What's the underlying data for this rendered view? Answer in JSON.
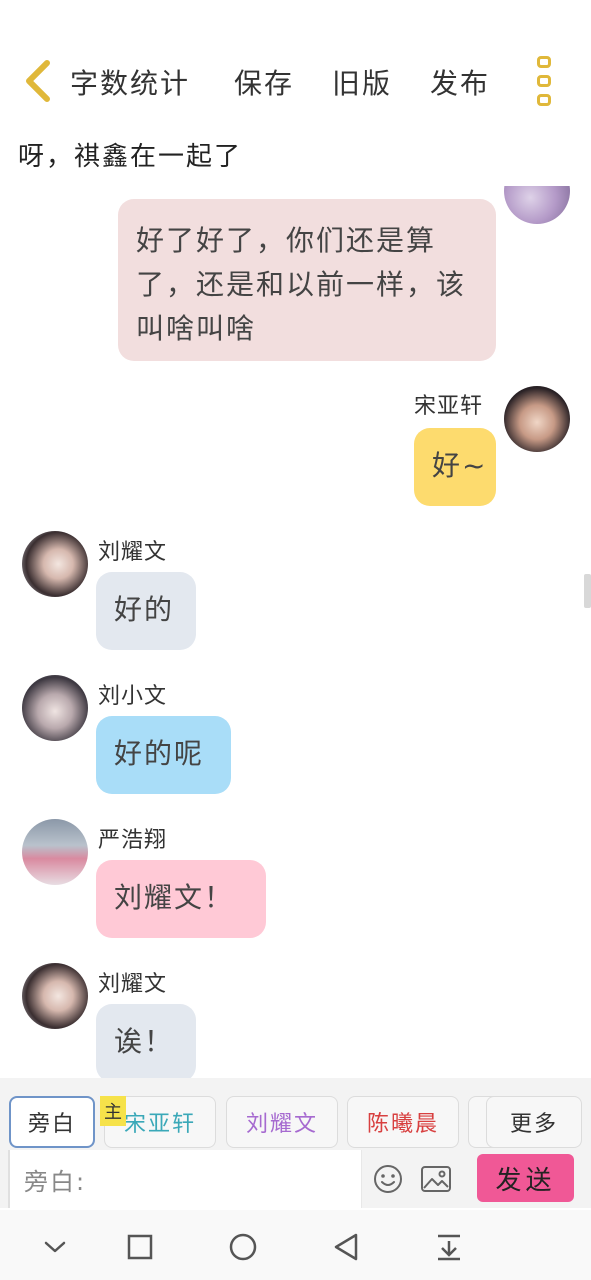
{
  "toolbar": {
    "word_count": "字数统计",
    "save": "保存",
    "old_version": "旧版",
    "publish": "发布"
  },
  "story_title": "呀，祺鑫在一起了",
  "messages": [
    {
      "side": "right",
      "name": "",
      "text": "好了好了，你们还是算了，还是和以前一样，该叫啥叫啥",
      "bubble_color": "#f2dede"
    },
    {
      "side": "right",
      "name": "宋亚轩",
      "text": "好~",
      "bubble_color": "#fddb6e"
    },
    {
      "side": "left",
      "name": "刘耀文",
      "text": "好的",
      "bubble_color": "#e3e8ef"
    },
    {
      "side": "left",
      "name": "刘小文",
      "text": "好的呢",
      "bubble_color": "#a9ddf8"
    },
    {
      "side": "left",
      "name": "严浩翔",
      "text": "刘耀文！",
      "bubble_color": "#ffc9d6"
    },
    {
      "side": "left",
      "name": "刘耀文",
      "text": "诶！",
      "bubble_color": "#e3e8ef"
    }
  ],
  "roles": {
    "narrator": "旁白",
    "main_tag": "主",
    "r1": "宋亚轩",
    "r1_color": "#3aa8b8",
    "r2": "刘耀文",
    "r2_color": "#a66ad0",
    "r3": "陈曦晨",
    "r3_color": "#d84040",
    "more": "更多"
  },
  "input": {
    "placeholder": "旁白:",
    "send": "发送"
  },
  "colors": {
    "accent_yellow": "#e0b83a",
    "send_pink": "#f05896"
  }
}
